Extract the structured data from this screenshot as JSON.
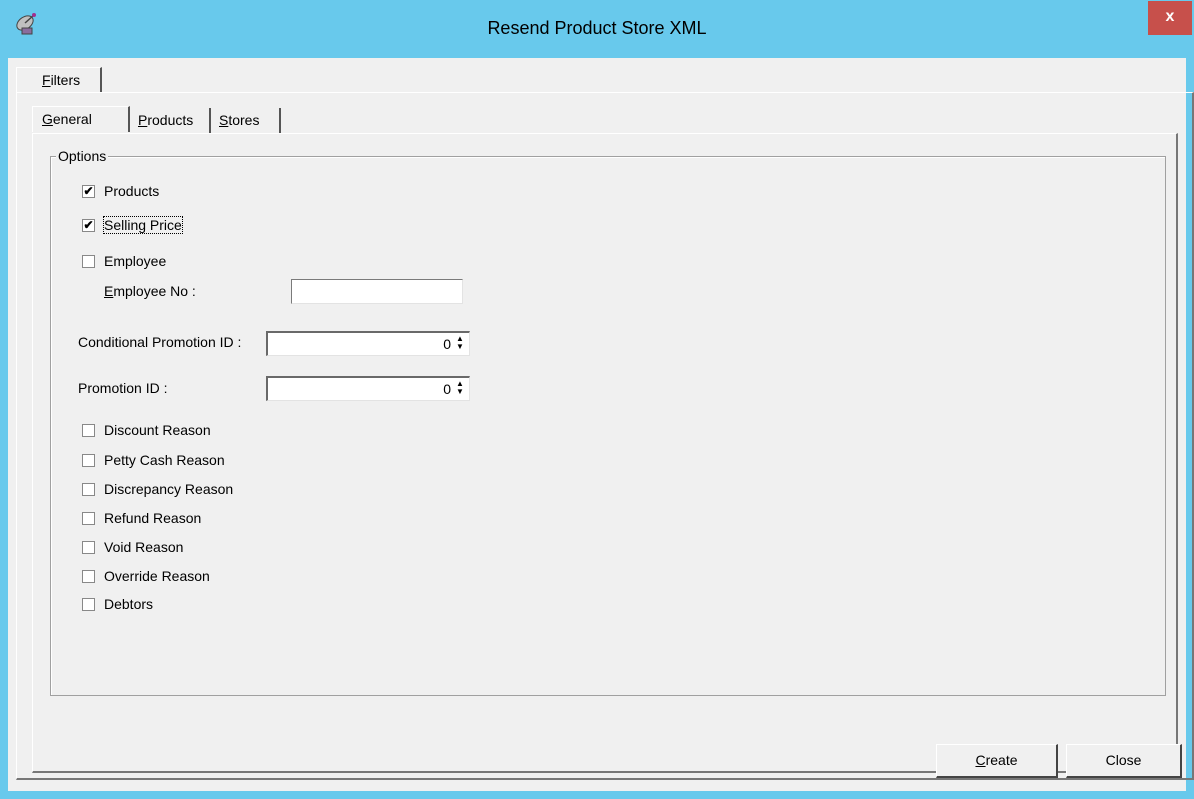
{
  "window": {
    "title": "Resend Product Store XML",
    "close_label": "x",
    "app_icon": "satellite-dish-icon",
    "titlebar_color": "#68c9ec",
    "close_color": "#c7504b"
  },
  "outer_tabs": [
    {
      "label": "Filters",
      "accel": "F",
      "rest": "ilters",
      "active": true
    }
  ],
  "inner_tabs": [
    {
      "label": "General",
      "accel": "G",
      "rest": "eneral",
      "active": true
    },
    {
      "label": "Products",
      "accel": "P",
      "rest": "roducts",
      "active": false
    },
    {
      "label": "Stores",
      "accel": "S",
      "rest": "tores",
      "active": false
    }
  ],
  "options": {
    "group_title": "Options",
    "products": {
      "label": "Products",
      "checked": true
    },
    "selling_price": {
      "label": "Selling Price",
      "checked": true
    },
    "employee": {
      "label": "Employee",
      "checked": false
    },
    "employee_no": {
      "accel": "E",
      "rest": "mployee No :",
      "value": ""
    },
    "conditional_promotion": {
      "label": "Conditional Promotion ID :",
      "value": "0"
    },
    "promotion": {
      "label": "Promotion ID :",
      "value": "0"
    },
    "reasons": [
      {
        "label": "Discount Reason",
        "checked": false
      },
      {
        "label": "Petty Cash Reason",
        "checked": false
      },
      {
        "label": "Discrepancy Reason",
        "checked": false
      },
      {
        "label": "Refund Reason",
        "checked": false
      },
      {
        "label": "Void Reason",
        "checked": false
      },
      {
        "label": "Override Reason",
        "checked": false
      },
      {
        "label": "Debtors",
        "checked": false
      }
    ]
  },
  "buttons": {
    "create": {
      "accel": "C",
      "rest": "reate"
    },
    "close": {
      "label": "Close"
    }
  }
}
